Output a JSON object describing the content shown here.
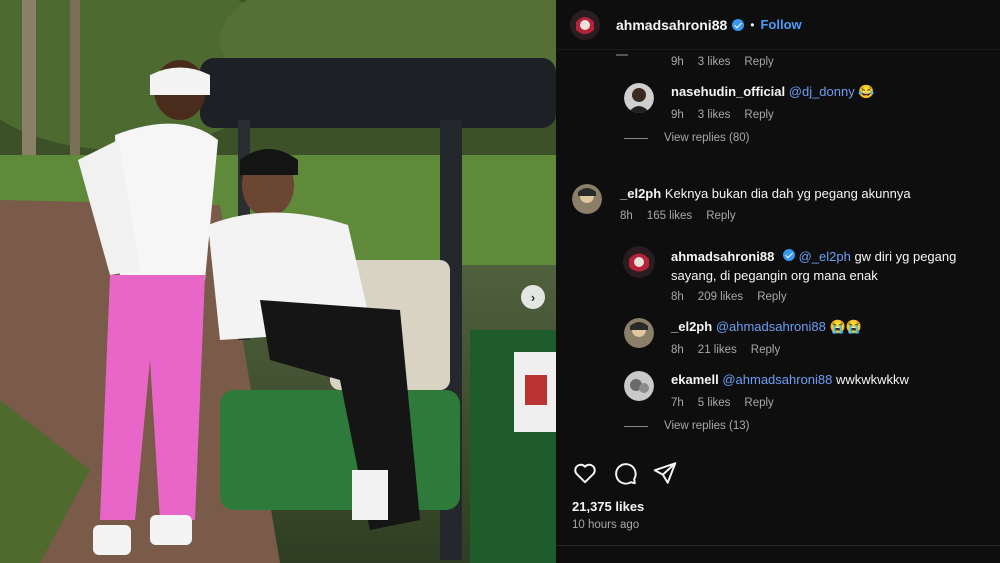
{
  "post": {
    "username": "ahmadsahroni88",
    "separator": "•",
    "follow_label": "Follow",
    "likes": "21,375 likes",
    "time": "10 hours ago"
  },
  "comments": {
    "partial": {
      "time": "9h",
      "likes": "3 likes",
      "reply": "Reply"
    },
    "nasehudin": {
      "user": "nasehudin_official",
      "mention": "@dj_donny",
      "text": " 😂",
      "time": "9h",
      "likes": "3 likes",
      "reply": "Reply"
    },
    "view_replies_1": "View replies (80)",
    "el2ph": {
      "user": "_el2ph",
      "text": "Keknya bukan dia dah yg pegang akunnya",
      "time": "8h",
      "likes": "165 likes",
      "reply": "Reply"
    },
    "sahroni_reply": {
      "user": "ahmadsahroni88",
      "mention": "@_el2ph",
      "text_line1": " gw diri yg pegang",
      "text_line2": "sayang, di pegangin org mana enak",
      "time": "8h",
      "likes": "209 likes",
      "reply": "Reply"
    },
    "el2ph_reply": {
      "user": "_el2ph",
      "mention": "@ahmadsahroni88",
      "text": " 😭😭",
      "time": "8h",
      "likes": "21 likes",
      "reply": "Reply"
    },
    "ekamell": {
      "user": "ekamell",
      "mention": "@ahmadsahroni88",
      "text": " wwkwkwkkw",
      "time": "7h",
      "likes": "5 likes",
      "reply": "Reply"
    },
    "view_replies_2": "View replies (13)"
  },
  "icons": [
    "heart-icon",
    "comment-icon",
    "share-icon",
    "verified-icon",
    "chevron-right-icon"
  ],
  "colors": {
    "background": "#0e0e0f",
    "mention": "#6d9ff5",
    "follow": "#4a9df8",
    "verified": "#3897f0",
    "muted": "#a8a8a8"
  }
}
